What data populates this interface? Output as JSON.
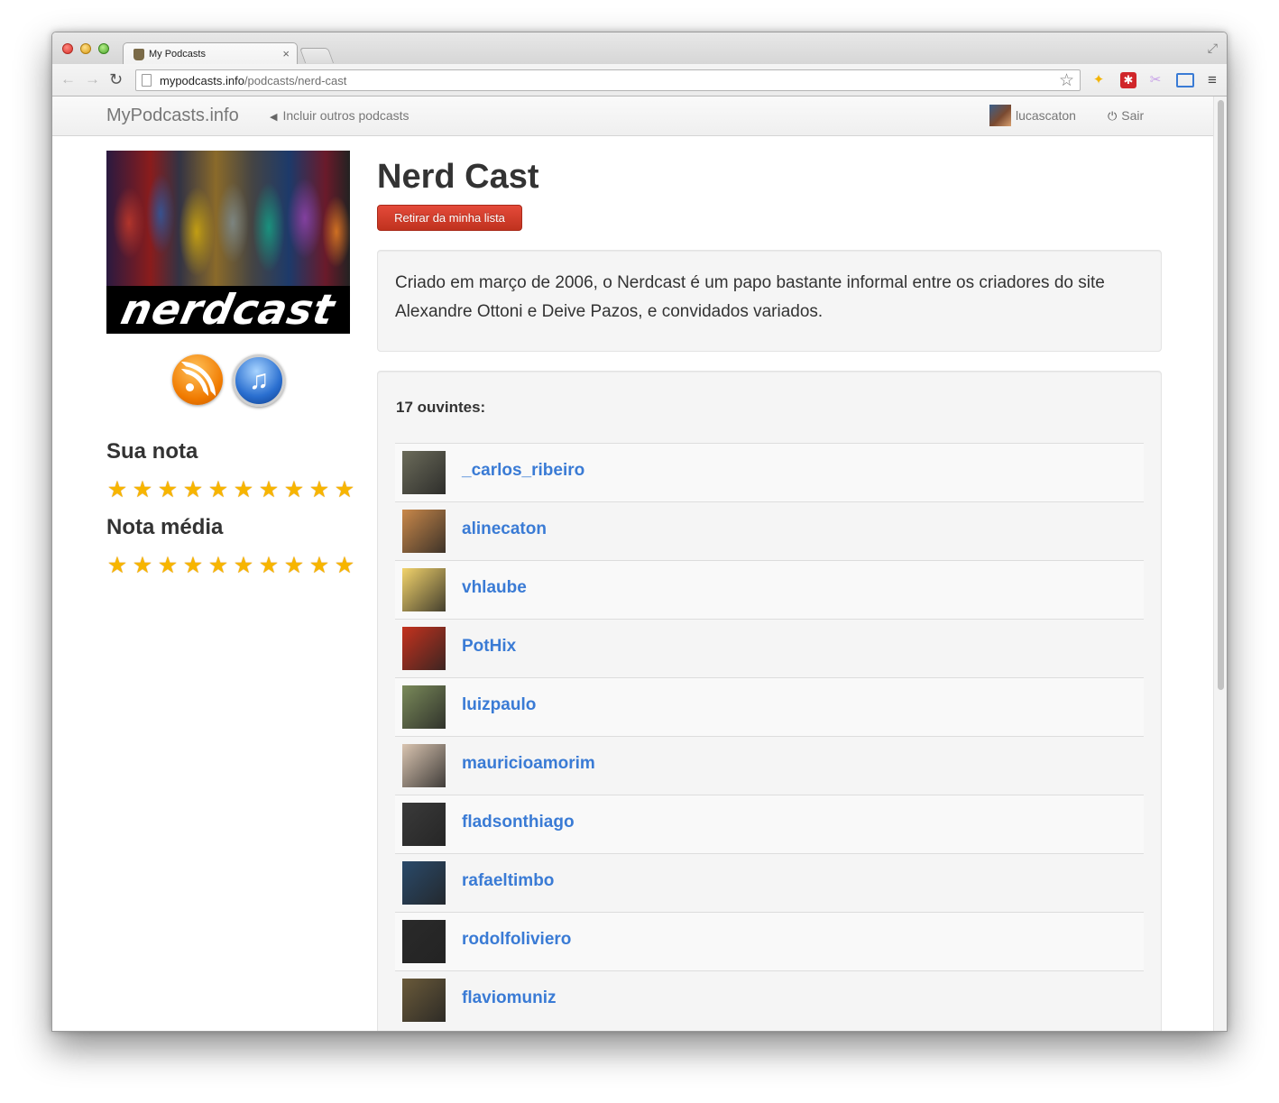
{
  "browser": {
    "tab_title": "My Podcasts",
    "tab_close": "×",
    "url_host": "mypodcasts.info",
    "url_path": "/podcasts/nerd-cast",
    "icons": [
      "back-arrow-icon",
      "forward-arrow-icon",
      "reload-icon",
      "page-icon",
      "bookmark-star-icon",
      "menu-icon"
    ]
  },
  "navbar": {
    "brand": "MyPodcasts.info",
    "browse_link": "Incluir outros podcasts",
    "username": "lucascaton",
    "logout": "Sair"
  },
  "podcast": {
    "title": "Nerd Cast",
    "cover_logo_text": "nerdcast",
    "unsubscribe_button": "Retirar da minha lista",
    "description": "Criado em março de 2006, o Nerdcast é um papo bastante informal entre os criadores do site Alexandre Ottoni e Deive Pazos, e convidados variados."
  },
  "ratings": {
    "my_rating_label": "Sua nota",
    "my_rating_stars": 10,
    "average_label": "Nota média",
    "average_stars": 10,
    "max_stars": 10
  },
  "listeners": {
    "count_label": "17 ouvintes:",
    "items": [
      {
        "name": "_carlos_ribeiro",
        "avatar_color": "#6b6b5a"
      },
      {
        "name": "alinecaton",
        "avatar_color": "#c9884a"
      },
      {
        "name": "vhlaube",
        "avatar_color": "#f2d36b"
      },
      {
        "name": "PotHix",
        "avatar_color": "#c4321e"
      },
      {
        "name": "luizpaulo",
        "avatar_color": "#7a8a5a"
      },
      {
        "name": "mauricioamorim",
        "avatar_color": "#d9c4b0"
      },
      {
        "name": "fladsonthiago",
        "avatar_color": "#3a3a3a"
      },
      {
        "name": "rafaeltimbo",
        "avatar_color": "#2a4a6a"
      },
      {
        "name": "rodolfoliviero",
        "avatar_color": "#2a2a2a"
      },
      {
        "name": "flaviomuniz",
        "avatar_color": "#6a5a3a"
      }
    ]
  },
  "colors": {
    "link_blue": "#3a7bd5",
    "danger_red": "#d43f2f",
    "star_gold": "#f7b500"
  }
}
